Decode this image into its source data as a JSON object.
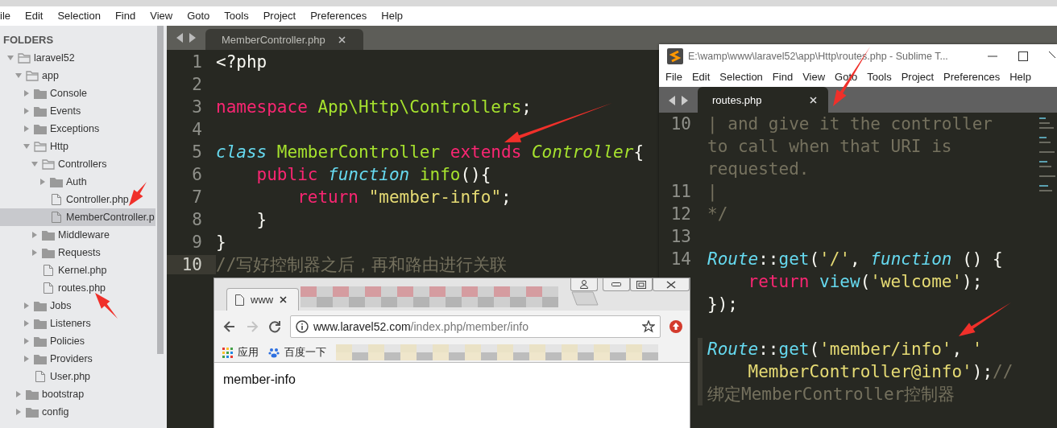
{
  "main_window": {
    "menu": [
      "ile",
      "Edit",
      "Selection",
      "Find",
      "View",
      "Goto",
      "Tools",
      "Project",
      "Preferences",
      "Help"
    ],
    "sidebar": {
      "header": "FOLDERS",
      "tree": [
        {
          "label": "laravel52",
          "kind": "folder",
          "expanded": true,
          "selected": false,
          "children": [
            {
              "label": "app",
              "kind": "folder",
              "expanded": true,
              "selected": false,
              "children": [
                {
                  "label": "Console",
                  "kind": "folder",
                  "expanded": false,
                  "selected": false
                },
                {
                  "label": "Events",
                  "kind": "folder",
                  "expanded": false,
                  "selected": false
                },
                {
                  "label": "Exceptions",
                  "kind": "folder",
                  "expanded": false,
                  "selected": false
                },
                {
                  "label": "Http",
                  "kind": "folder",
                  "expanded": true,
                  "selected": false,
                  "children": [
                    {
                      "label": "Controllers",
                      "kind": "folder",
                      "expanded": true,
                      "selected": false,
                      "children": [
                        {
                          "label": "Auth",
                          "kind": "folder",
                          "expanded": false,
                          "selected": false
                        },
                        {
                          "label": "Controller.php",
                          "kind": "file",
                          "selected": false
                        },
                        {
                          "label": "MemberController.p",
                          "kind": "file",
                          "selected": true
                        }
                      ]
                    },
                    {
                      "label": "Middleware",
                      "kind": "folder",
                      "expanded": false,
                      "selected": false
                    },
                    {
                      "label": "Requests",
                      "kind": "folder",
                      "expanded": false,
                      "selected": false
                    },
                    {
                      "label": "Kernel.php",
                      "kind": "file",
                      "selected": false
                    },
                    {
                      "label": "routes.php",
                      "kind": "file",
                      "selected": false
                    }
                  ]
                },
                {
                  "label": "Jobs",
                  "kind": "folder",
                  "expanded": false,
                  "selected": false
                },
                {
                  "label": "Listeners",
                  "kind": "folder",
                  "expanded": false,
                  "selected": false
                },
                {
                  "label": "Policies",
                  "kind": "folder",
                  "expanded": false,
                  "selected": false
                },
                {
                  "label": "Providers",
                  "kind": "folder",
                  "expanded": false,
                  "selected": false
                },
                {
                  "label": "User.php",
                  "kind": "file",
                  "selected": false
                }
              ]
            },
            {
              "label": "bootstrap",
              "kind": "folder",
              "expanded": false,
              "selected": false
            },
            {
              "label": "config",
              "kind": "folder",
              "expanded": false,
              "selected": false
            }
          ]
        }
      ]
    },
    "tabs": [
      {
        "label": "MemberController.php",
        "selected": true
      }
    ],
    "code_lines": [
      {
        "number": "1",
        "current": false,
        "tokens": [
          {
            "text": "<?php",
            "kind": "plain"
          }
        ]
      },
      {
        "number": "2",
        "current": false
      },
      {
        "number": "3",
        "current": false,
        "tokens": [
          {
            "text": "namespace",
            "kind": "keyword"
          },
          {
            "text": " App\\Http\\Controllers",
            "kind": "entity"
          },
          {
            "text": ";",
            "kind": "plain"
          }
        ]
      },
      {
        "number": "4",
        "current": false
      },
      {
        "number": "5",
        "current": false,
        "tokens": [
          {
            "text": "class",
            "kind": "storage"
          },
          {
            "text": " MemberController",
            "kind": "entity"
          },
          {
            "text": " extends",
            "kind": "keyword"
          },
          {
            "text": " Controller",
            "kind": "inherited"
          },
          {
            "text": "{",
            "kind": "plain"
          }
        ]
      },
      {
        "number": "6",
        "current": false,
        "tokens": [
          {
            "text": "    public",
            "kind": "keyword"
          },
          {
            "text": " function",
            "kind": "storage"
          },
          {
            "text": " info",
            "kind": "entity"
          },
          {
            "text": "(){",
            "kind": "plain"
          }
        ]
      },
      {
        "number": "7",
        "current": false,
        "tokens": [
          {
            "text": "        return",
            "kind": "keyword"
          },
          {
            "text": " \"member-info\"",
            "kind": "string"
          },
          {
            "text": ";",
            "kind": "plain"
          }
        ]
      },
      {
        "number": "8",
        "current": false,
        "tokens": [
          {
            "text": "    }",
            "kind": "plain"
          }
        ]
      },
      {
        "number": "9",
        "current": false,
        "tokens": [
          {
            "text": "}",
            "kind": "plain"
          }
        ]
      },
      {
        "number": "10",
        "current": true,
        "tokens": [
          {
            "text": "//写好控制器之后，再和路由进行关联",
            "kind": "comment"
          }
        ]
      }
    ]
  },
  "routes_window": {
    "title": "E:\\wamp\\www\\laravel52\\app\\Http\\routes.php - Sublime T...",
    "menu": [
      "File",
      "Edit",
      "Selection",
      "Find",
      "View",
      "Goto",
      "Tools",
      "Project",
      "Preferences",
      "Help"
    ],
    "tabs": [
      {
        "label": "routes.php",
        "selected": true
      }
    ],
    "code_lines": [
      {
        "number": "10",
        "current": false,
        "tokens": [
          {
            "text": "| and give it the controller",
            "kind": "comment"
          }
        ]
      },
      {
        "current": false,
        "tokens": [
          {
            "text": "to call when that URI is",
            "kind": "comment"
          }
        ]
      },
      {
        "current": false,
        "tokens": [
          {
            "text": "requested.",
            "kind": "comment"
          }
        ]
      },
      {
        "number": "11",
        "current": false,
        "tokens": [
          {
            "text": "|",
            "kind": "comment"
          }
        ]
      },
      {
        "number": "12",
        "current": false,
        "tokens": [
          {
            "text": "*/",
            "kind": "comment"
          }
        ]
      },
      {
        "number": "13",
        "current": false
      },
      {
        "number": "14",
        "current": false,
        "tokens": [
          {
            "text": "Route",
            "kind": "storage"
          },
          {
            "text": "::",
            "kind": "plain"
          },
          {
            "text": "get",
            "kind": "support"
          },
          {
            "text": "(",
            "kind": "plain"
          },
          {
            "text": "'/'",
            "kind": "string"
          },
          {
            "text": ", ",
            "kind": "plain"
          },
          {
            "text": "function",
            "kind": "storage"
          },
          {
            "text": " () {",
            "kind": "plain"
          }
        ]
      },
      {
        "current": false,
        "tokens": [
          {
            "text": "    return",
            "kind": "keyword"
          },
          {
            "text": " view",
            "kind": "support"
          },
          {
            "text": "(",
            "kind": "plain"
          },
          {
            "text": "'welcome'",
            "kind": "string"
          },
          {
            "text": ");",
            "kind": "plain"
          }
        ]
      },
      {
        "current": false,
        "tokens": [
          {
            "text": "});",
            "kind": "plain"
          }
        ]
      },
      {
        "current": false
      },
      {
        "current": true,
        "tokens": [
          {
            "text": "Route",
            "kind": "storage"
          },
          {
            "text": "::",
            "kind": "plain"
          },
          {
            "text": "get",
            "kind": "support"
          },
          {
            "text": "(",
            "kind": "plain"
          },
          {
            "text": "'member/info'",
            "kind": "string"
          },
          {
            "text": ", ",
            "kind": "plain"
          },
          {
            "text": "'",
            "kind": "string"
          }
        ]
      },
      {
        "current": true,
        "tokens": [
          {
            "text": "    MemberController@info'",
            "kind": "string"
          },
          {
            "text": ");",
            "kind": "plain"
          },
          {
            "text": "//",
            "kind": "comment"
          }
        ]
      },
      {
        "current": true,
        "tokens": [
          {
            "text": "绑定MemberController控制器",
            "kind": "comment"
          }
        ]
      }
    ]
  },
  "browser": {
    "tabs": [
      {
        "label": "www",
        "selected": true
      }
    ],
    "nav": [
      {
        "kind": "back",
        "disabled": false
      },
      {
        "kind": "forward",
        "disabled": true
      },
      {
        "kind": "reload",
        "disabled": false
      }
    ],
    "address": {
      "host": "www.laravel52.com",
      "path": "/index.php/member/info"
    },
    "bookmarks": [
      {
        "label": "应用",
        "kind": "apps"
      },
      {
        "label": "百度一下",
        "kind": "paw"
      }
    ],
    "content": "member-info"
  }
}
